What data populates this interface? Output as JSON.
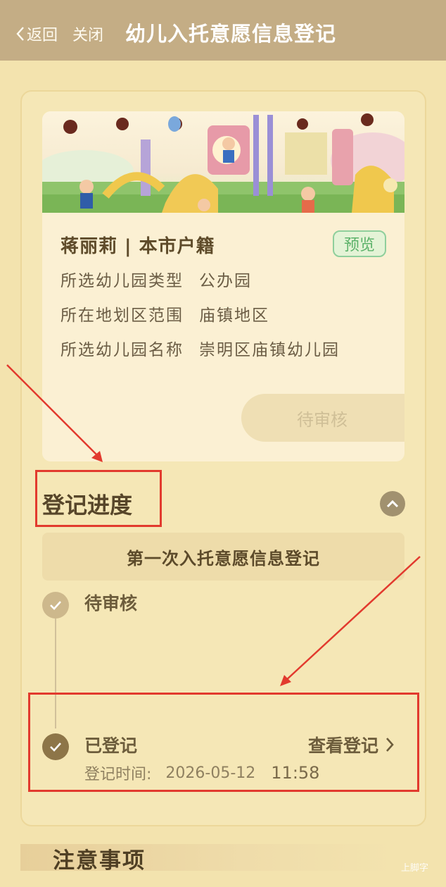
{
  "nav": {
    "back_label": "返回",
    "close_label": "关闭",
    "title": "幼儿入托意愿信息登记"
  },
  "card": {
    "applicant": "蒋丽莉 | 本市户籍",
    "preview_label": "预览",
    "rows": [
      {
        "label": "所选幼儿园类型",
        "value": "公办园"
      },
      {
        "label": "所在地划区范围",
        "value": "庙镇地区"
      },
      {
        "label": "所选幼儿园名称",
        "value": "崇明区庙镇幼儿园"
      }
    ],
    "status": "待审核"
  },
  "progress": {
    "title": "登记进度",
    "stage": "第一次入托意愿信息登记",
    "steps": [
      {
        "label": "待审核"
      },
      {
        "label": "已登记",
        "link": "查看登记",
        "time_label": "登记时间:",
        "date": "2026-05-12",
        "time": "11:58"
      }
    ]
  },
  "notes": {
    "title": "注意事项"
  },
  "watermark": "上脚字",
  "colors": {
    "navbar": "#c4ad85",
    "background": "#f3e3ae",
    "annotation_red": "#e23a2e",
    "preview_green": "#5cb26a"
  }
}
